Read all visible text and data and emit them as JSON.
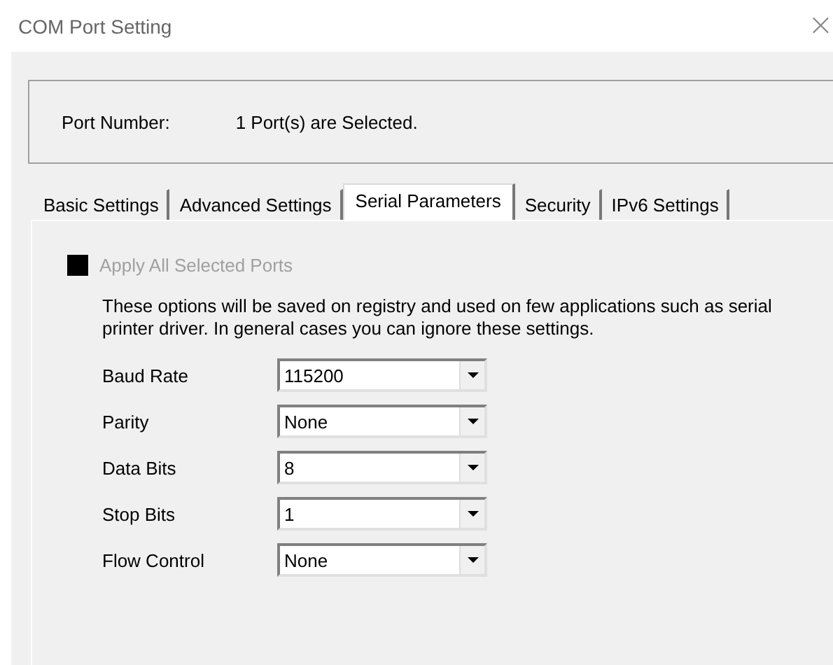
{
  "window": {
    "title": "COM Port Setting",
    "close": "×"
  },
  "port": {
    "label": "Port Number:",
    "value": "1 Port(s) are Selected."
  },
  "tabs": [
    {
      "label": "Basic Settings",
      "selected": false
    },
    {
      "label": "Advanced Settings",
      "selected": false
    },
    {
      "label": "Serial Parameters",
      "selected": true
    },
    {
      "label": "Security",
      "selected": false
    },
    {
      "label": "IPv6 Settings",
      "selected": false
    }
  ],
  "apply_all": {
    "label": "Apply All Selected Ports",
    "disabled": true
  },
  "note": "These options will be saved on registry and used on few applications such as serial printer driver. In general cases you can ignore these settings.",
  "fields": [
    {
      "label": "Baud Rate",
      "value": "115200"
    },
    {
      "label": "Parity",
      "value": "None"
    },
    {
      "label": "Data Bits",
      "value": "8"
    },
    {
      "label": "Stop Bits",
      "value": "1"
    },
    {
      "label": "Flow Control",
      "value": "None"
    }
  ]
}
